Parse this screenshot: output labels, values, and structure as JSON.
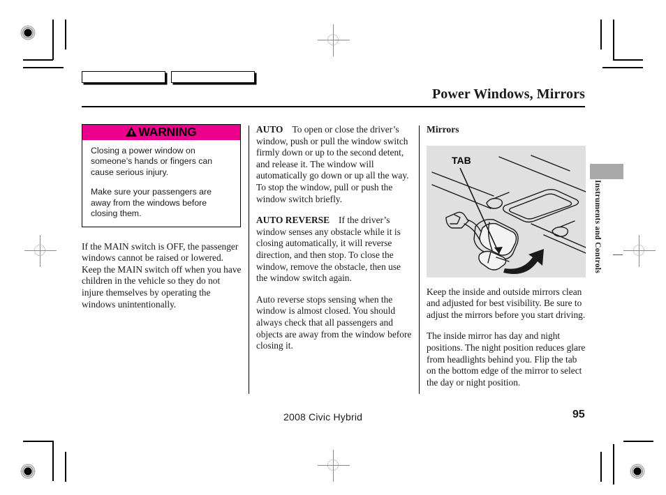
{
  "header": {
    "title": "Power Windows, Mirrors",
    "tab_boxes": [
      "",
      ""
    ]
  },
  "side_index": {
    "label": "Instruments and Controls"
  },
  "warning": {
    "heading": "WARNING",
    "icon": "warning-triangle-icon",
    "accent_color": "#ec008c",
    "paragraphs": [
      "Closing a power window on someone’s hands or fingers can cause serious injury.",
      "Make sure your passengers are away from the windows before closing them."
    ]
  },
  "columns": {
    "left": {
      "body": "If the MAIN switch is OFF, the passenger windows cannot be raised or lowered. Keep the MAIN switch off when you have children in the vehicle so they do not injure themselves by operating the windows unintentionally."
    },
    "middle": {
      "auto_label": "AUTO",
      "auto_body": "To open or close the driver’s window, push or pull the window switch firmly down or up to the second detent, and release it. The window will automatically go down or up all the way. To stop the window, pull or push the window switch briefly.",
      "auto_reverse_label": "AUTO REVERSE",
      "auto_reverse_body": "If the driver’s window senses any obstacle while it is closing automatically, it will reverse direction, and then stop. To close the window, remove the obstacle, then use the window switch again.",
      "closing_body": "Auto reverse stops sensing when the window is almost closed. You should always check that all passengers and objects are away from the window before closing it."
    },
    "right": {
      "heading": "Mirrors",
      "illustration_label": "TAB",
      "body_1": "Keep the inside and outside mirrors clean and adjusted for best visibility. Be sure to adjust the mirrors before you start driving.",
      "body_2": "The inside mirror has day and night positions. The night position reduces glare from headlights behind you. Flip the tab on the bottom edge of the mirror to select the day or night position."
    }
  },
  "footer": {
    "model": "2008  Civic  Hybrid",
    "page_number": "95"
  }
}
